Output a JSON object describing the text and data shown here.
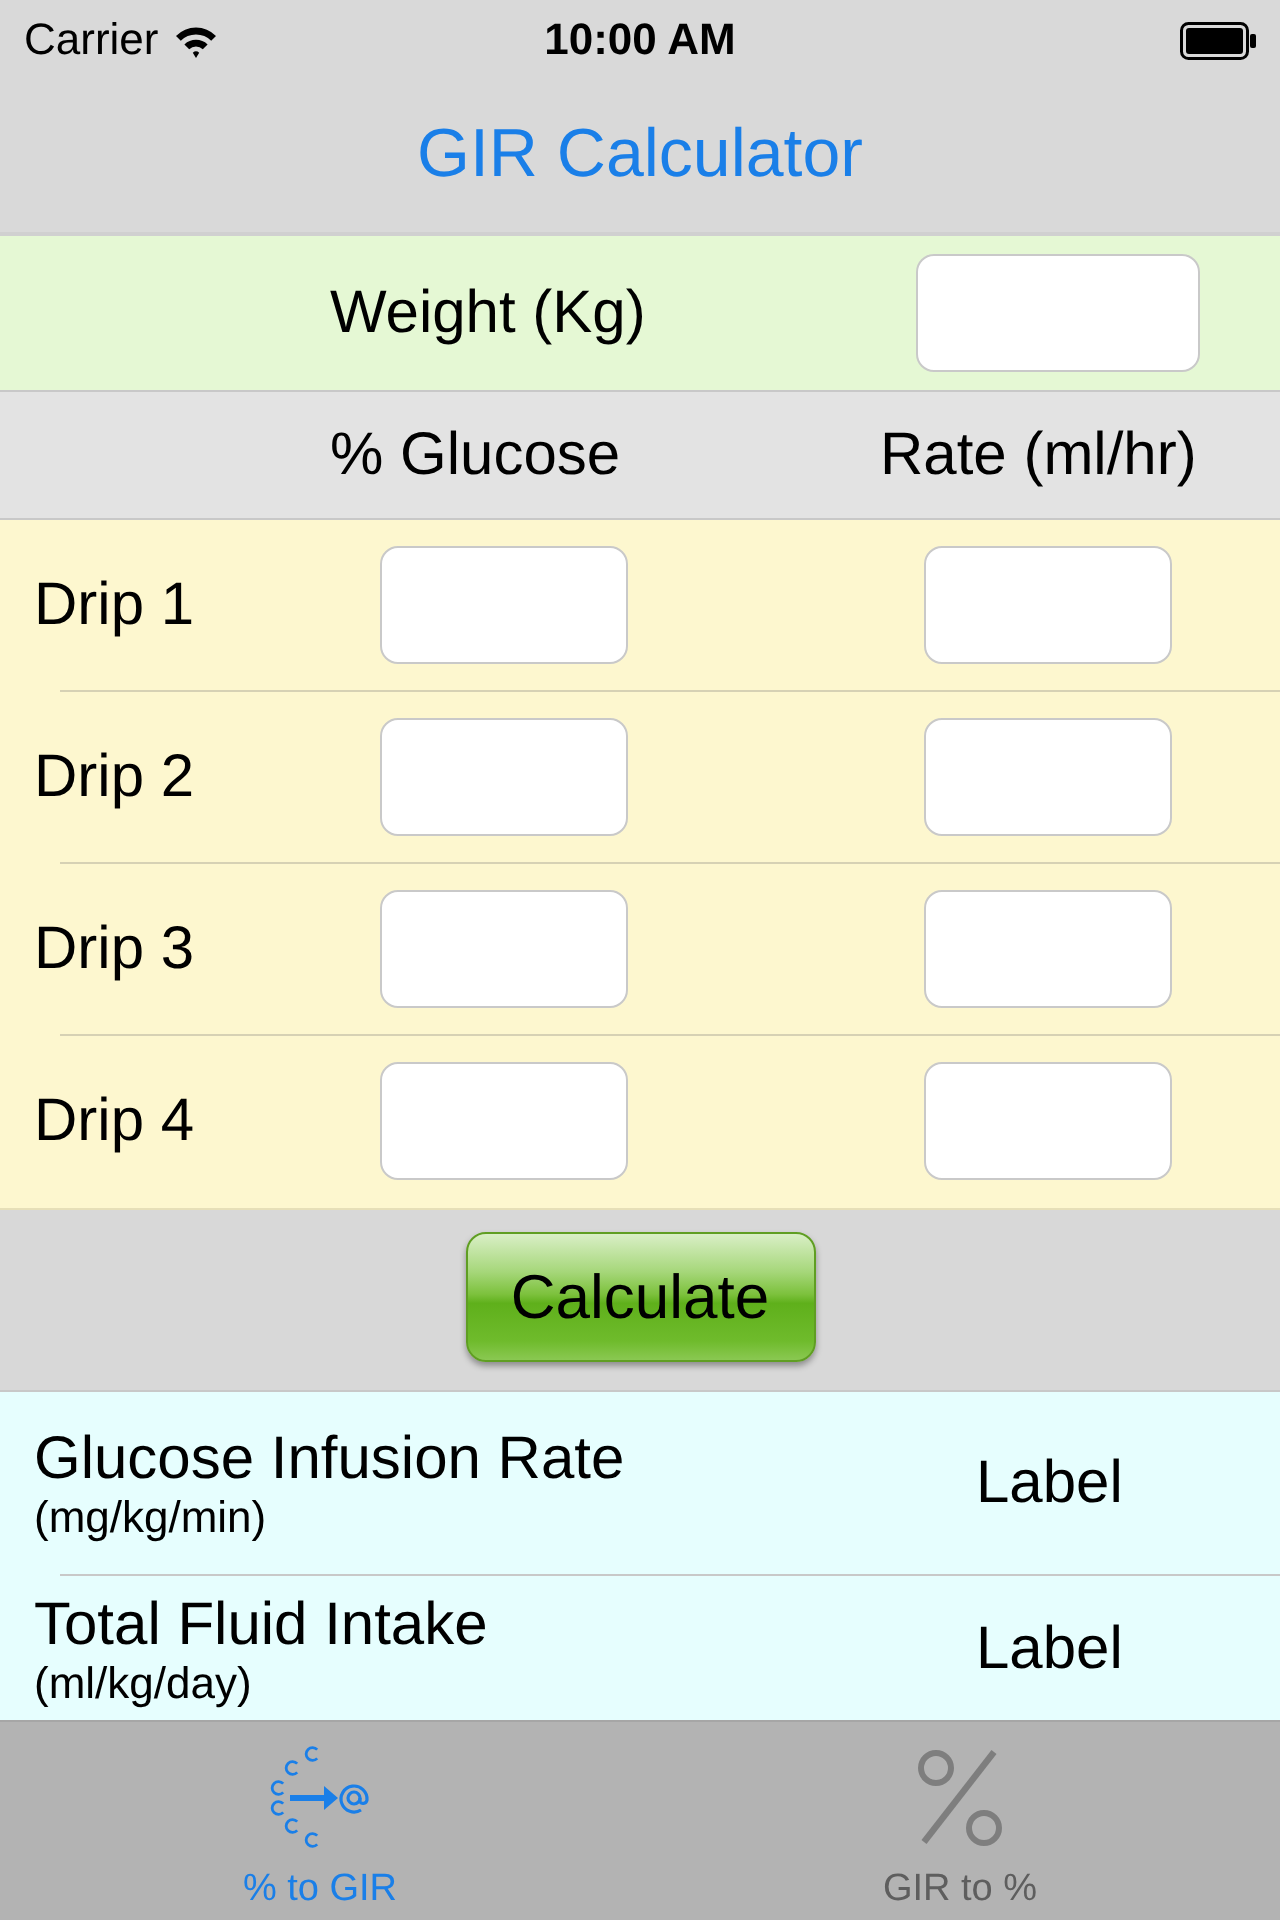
{
  "status_bar": {
    "carrier": "Carrier",
    "time": "10:00 AM"
  },
  "nav_bar": {
    "title": "GIR Calculator"
  },
  "weight": {
    "label": "Weight (Kg)"
  },
  "drip_table": {
    "columns": [
      "% Glucose",
      "Rate (ml/hr)"
    ],
    "rows": [
      {
        "label": "Drip 1"
      },
      {
        "label": "Drip 2"
      },
      {
        "label": "Drip 3"
      },
      {
        "label": "Drip 4"
      }
    ]
  },
  "calculate_button": "Calculate",
  "results": [
    {
      "name": "Glucose Infusion Rate",
      "unit": "(mg/kg/min)",
      "value": "Label"
    },
    {
      "name": "Total Fluid Intake",
      "unit": "(ml/kg/day)",
      "value": "Label"
    }
  ],
  "tab_bar": [
    {
      "label": "% to GIR",
      "kind": "scatter",
      "selected": true
    },
    {
      "label": "GIR to %",
      "kind": "percent",
      "selected": false
    }
  ]
}
